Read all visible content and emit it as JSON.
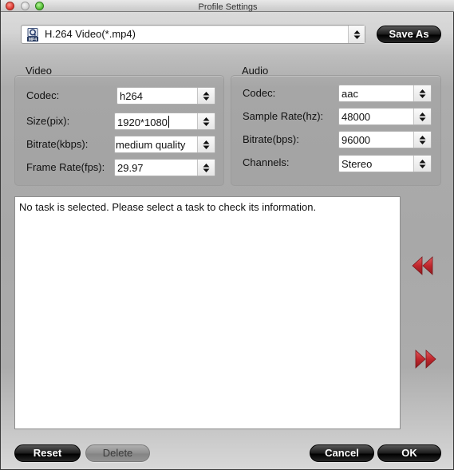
{
  "window": {
    "title": "Profile Settings"
  },
  "profile": {
    "icon": "mp4-format-icon",
    "icon_badge": "MP4",
    "selected": "H.264 Video(*.mp4)",
    "save_as_label": "Save As"
  },
  "video": {
    "group_label": "Video",
    "fields": [
      {
        "label": "Codec:",
        "value": "h264"
      },
      {
        "label": "Size(pix):",
        "value": "1920*1080"
      },
      {
        "label": "Bitrate(kbps):",
        "value": "medium quality"
      },
      {
        "label": "Frame Rate(fps):",
        "value": "29.97"
      }
    ]
  },
  "audio": {
    "group_label": "Audio",
    "fields": [
      {
        "label": "Codec:",
        "value": "aac"
      },
      {
        "label": "Sample Rate(hz):",
        "value": "48000"
      },
      {
        "label": "Bitrate(bps):",
        "value": "96000"
      },
      {
        "label": "Channels:",
        "value": "Stereo"
      }
    ]
  },
  "info": {
    "message": "No task is selected. Please select a task to check its information."
  },
  "nav": {
    "previous_icon": "rewind-icon",
    "next_icon": "fast-forward-icon",
    "arrow_color": "#c0272d"
  },
  "footer": {
    "reset_label": "Reset",
    "delete_label": "Delete",
    "cancel_label": "Cancel",
    "ok_label": "OK"
  }
}
